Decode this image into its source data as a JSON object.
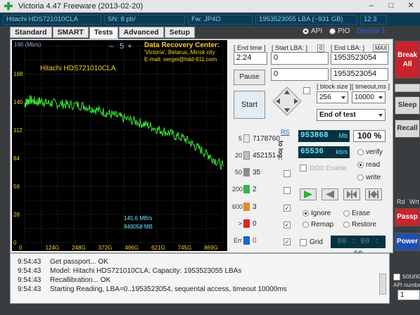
{
  "window": {
    "title": "Victoria 4.47  Freeware (2013-02-20)",
    "minimize": "–",
    "maximize": "□",
    "close": "✕"
  },
  "infobar": {
    "model": "Hitachi HDS721010CLA",
    "serial": "SN: 8            pb/",
    "firmware": "Fw: JP4O",
    "capacity": "1953523055 LBA (~931 GB)",
    "clock": "12:3"
  },
  "tabs": [
    "Standard",
    "SMART",
    "Tests",
    "Advanced",
    "Setup"
  ],
  "active_tab": "Tests",
  "mode": {
    "api": "API",
    "pio": "PIO",
    "device": "Device 1"
  },
  "graph": {
    "unit": "196 (Mb/s)",
    "drive_label": "Hitachi HDS721010CLA",
    "step_minus": "–",
    "step_value": "5",
    "step_plus": "+",
    "recovery_line1": "Data Recovery Center:",
    "recovery_line2": "'Victoria', Belarus, Minsk city",
    "recovery_line3": "E-mail: sergei@hdd-911.com",
    "y_ticks": [
      "168",
      "140",
      "112",
      "84",
      "56",
      "28",
      "0"
    ],
    "x_ticks": [
      "0",
      "124G",
      "248G",
      "372G",
      "496G",
      "621G",
      "745G",
      "869G"
    ],
    "speed_readout": "145,6 MB/s",
    "kb_readout": "949058 MB"
  },
  "chart_data": {
    "type": "line",
    "title": "",
    "xlabel": "",
    "ylabel": "196 (Mb/s)",
    "x_unit": "G",
    "xlim": [
      0,
      931
    ],
    "ylim": [
      0,
      196
    ],
    "grid": true,
    "series": [
      {
        "x": [
          0,
          10,
          20,
          40,
          60,
          80,
          100,
          124,
          150,
          180,
          210,
          248,
          280,
          310,
          340,
          372,
          400,
          430,
          460,
          496,
          530,
          560,
          590,
          621,
          650,
          680,
          710,
          745,
          775,
          800,
          830,
          860,
          869,
          900,
          931
        ],
        "values": [
          138,
          140,
          142,
          141,
          140,
          141,
          139,
          139,
          138,
          138,
          137,
          137,
          136,
          134,
          132,
          130,
          128,
          126,
          124,
          122,
          120,
          118,
          116,
          113,
          111,
          109,
          106,
          104,
          100,
          96,
          92,
          87,
          86,
          81,
          76
        ]
      }
    ]
  },
  "controls": {
    "end_time_label": "[ End time ]",
    "end_time_value": "2:24",
    "start_lba_label": "[ Start LBA: ]",
    "start_lba_value": "0",
    "start_lba_reset": "0",
    "end_lba_label": "[ End LBA: ]",
    "end_lba_max": "MAX",
    "end_lba_value": "1953523054",
    "current_value": "0",
    "current_lba_value": "1953523054",
    "pause_label": "Pause",
    "start_label": "Start",
    "block_size_label": "[ block size ]",
    "block_size_value": "256",
    "timeout_label": "[ timeout,ms ]",
    "timeout_value": "10000",
    "end_of_test": "End of test"
  },
  "stats": {
    "rs_label": "RS",
    "to_log_label": "to log:",
    "rows": [
      {
        "label": "5",
        "color": "#e6e6e6",
        "value": "7178760",
        "checked": ""
      },
      {
        "label": "20",
        "color": "#bdbdbd",
        "value": "452151",
        "checked": ""
      },
      {
        "label": "50",
        "color": "#8c8c8c",
        "value": "35",
        "checked": ""
      },
      {
        "label": "200",
        "color": "#36b34a",
        "value": "2",
        "checked": ""
      },
      {
        "label": "600",
        "color": "#e9882a",
        "value": "3",
        "checked": "✓"
      },
      {
        "label": ">",
        "color": "#e02424",
        "value": "0",
        "checked": "✓"
      },
      {
        "label": "Err",
        "color": "#1f5fd6",
        "value": "0",
        "checked": "✓"
      }
    ]
  },
  "progress": {
    "mb_value": "953868",
    "mb_unit": "Mb",
    "percent": "100",
    "percent_sign": "%",
    "speed_value": "65536",
    "speed_unit": "kb/s",
    "verify": "verify",
    "read": "read",
    "write": "write",
    "ddd_enable": "DDD Enable"
  },
  "actions": {
    "ignore": "Ignore",
    "erase": "Erase",
    "remap": "Remap",
    "restore": "Restore",
    "grid": "Grid",
    "timer": "00 : 00 : 00"
  },
  "side": {
    "break_all": "Break All",
    "sleep": "Sleep",
    "recall": "Recall",
    "rd": "Rd",
    "wrt": "Wrt",
    "passp": "Passp",
    "power": "Power",
    "sound": "sound",
    "api_number": "API numbe",
    "api_number_value": "1"
  },
  "log": [
    {
      "time": "9:54:43",
      "text": "Get passport... OK"
    },
    {
      "time": "9:54:43",
      "text": "Model: Hitachi HDS721010CLA; Capacity: 1953523055 LBAs"
    },
    {
      "time": "9:54:43",
      "text": "Recallibration... OK"
    },
    {
      "time": "9:54:43",
      "text": "Starting Reading, LBA=0..1953523054, sequental access, timeout 10000ms"
    }
  ]
}
